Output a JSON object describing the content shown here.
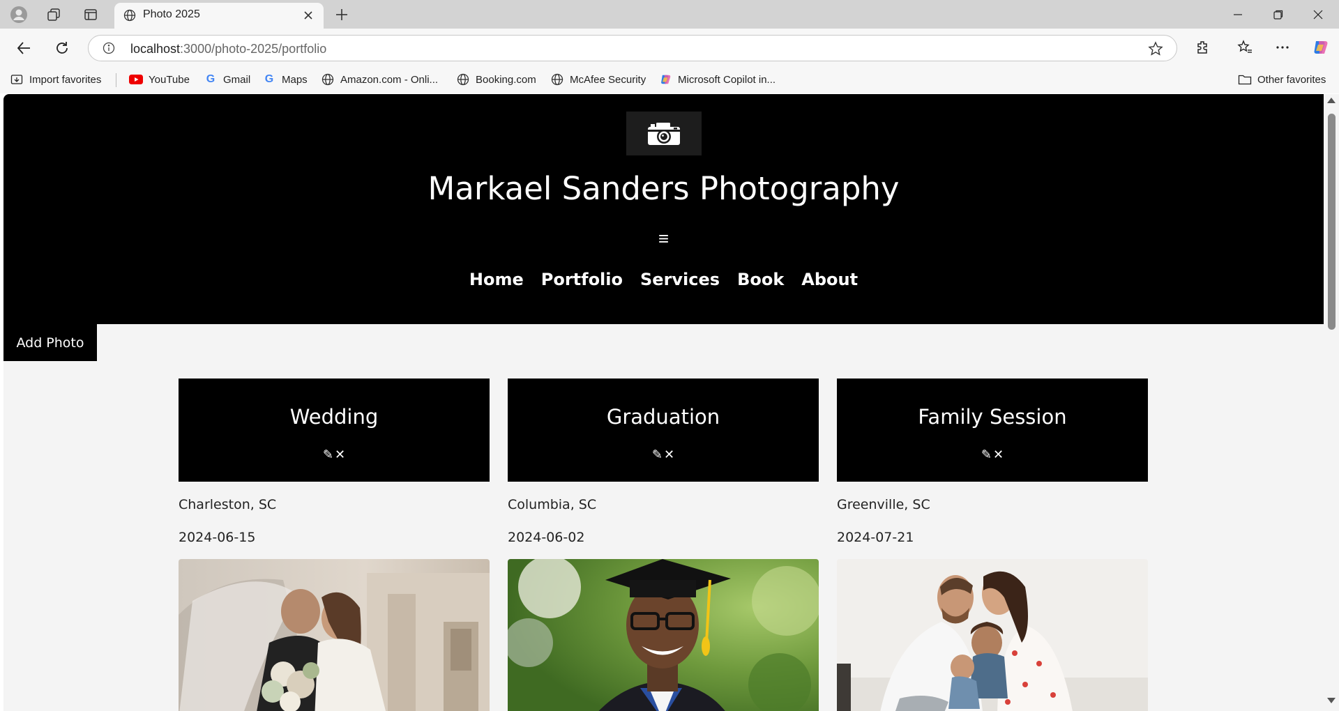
{
  "browser": {
    "tab": {
      "title": "Photo 2025",
      "icon": "globe-icon"
    },
    "url_host": "localhost",
    "url_path": ":3000/photo-2025/portfolio",
    "favorites": [
      {
        "label": "Import favorites",
        "icon": "import-icon"
      },
      {
        "label": "YouTube",
        "icon": "youtube-icon"
      },
      {
        "label": "Gmail",
        "icon": "google-icon"
      },
      {
        "label": "Maps",
        "icon": "google-icon"
      },
      {
        "label": "Amazon.com - Onli...",
        "icon": "globe-icon"
      },
      {
        "label": "Booking.com",
        "icon": "globe-icon"
      },
      {
        "label": "McAfee Security",
        "icon": "globe-icon"
      },
      {
        "label": "Microsoft Copilot in...",
        "icon": "copilot-icon"
      }
    ],
    "other_favorites": "Other favorites"
  },
  "site": {
    "title": "Markael Sanders Photography",
    "menu_glyph": "≡",
    "nav": [
      "Home",
      "Portfolio",
      "Services",
      "Book",
      "About"
    ],
    "add_photo_label": "Add Photo"
  },
  "cards": [
    {
      "title": "Wedding",
      "edit_glyph": "✎",
      "delete_glyph": "✕",
      "location": "Charleston, SC",
      "date": "2024-06-15",
      "photo": "wedding-couple-photo"
    },
    {
      "title": "Graduation",
      "edit_glyph": "✎",
      "delete_glyph": "✕",
      "location": "Columbia, SC",
      "date": "2024-06-02",
      "photo": "graduate-portrait-photo"
    },
    {
      "title": "Family Session",
      "edit_glyph": "✎",
      "delete_glyph": "✕",
      "location": "Greenville, SC",
      "date": "2024-07-21",
      "photo": "family-bed-photo"
    }
  ],
  "colors": {
    "header_bg": "#000000",
    "page_bg": "#f4f4f4",
    "text_light": "#ffffff"
  }
}
